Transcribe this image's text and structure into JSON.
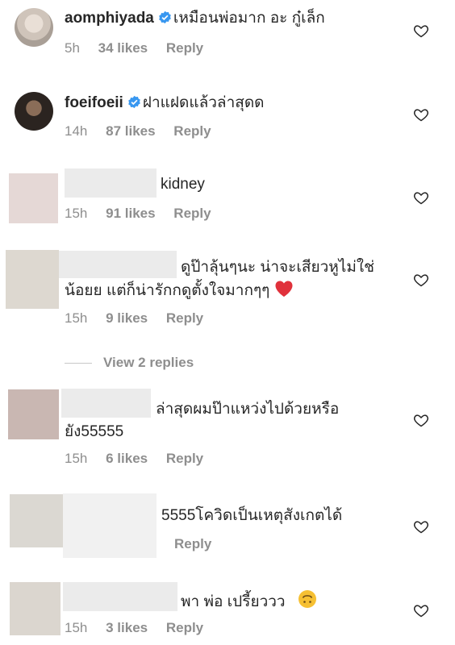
{
  "comments": [
    {
      "user": "aomphiyada",
      "text": "เหมือนพ่อมาก อะ กู๋เล็ก",
      "time": "5h",
      "likes": "34 likes",
      "reply": "Reply"
    },
    {
      "user": "foeifoeii",
      "text": "ฝาแฝดแล้วล่าสุดด",
      "time": "14h",
      "likes": "87 likes",
      "reply": "Reply"
    },
    {
      "text": "kidney",
      "time": "15h",
      "likes": "91 likes",
      "reply": "Reply"
    },
    {
      "text_line1": "ดูป๊าลุ้นๆนะ น่าจะเสียวหูไม่ใช่",
      "text_line2": "น้อยย แต่ก็น่ารักกดูตั้งใจมากๆๆ",
      "time": "15h",
      "likes": "9 likes",
      "reply": "Reply",
      "emoji": "red-heart-emoji"
    },
    {
      "text_line1": "ล่าสุดผมป๊าแหว่งไปด้วยหรือ",
      "text_line2": "ยัง55555",
      "time": "15h",
      "likes": "6 likes",
      "reply": "Reply"
    },
    {
      "text": "5555โควิดเป็นเหตุสังเกตได้",
      "reply": "Reply"
    },
    {
      "text": "พา พ่อ เปรี้ยววว",
      "time": "15h",
      "likes": "3 likes",
      "reply": "Reply",
      "emoji": "upside-down-face-emoji"
    }
  ],
  "view_replies": "View 2 replies",
  "colors": {
    "verified": "#3897f0",
    "muted": "#8e8e8e",
    "heart": "#ed4956"
  }
}
